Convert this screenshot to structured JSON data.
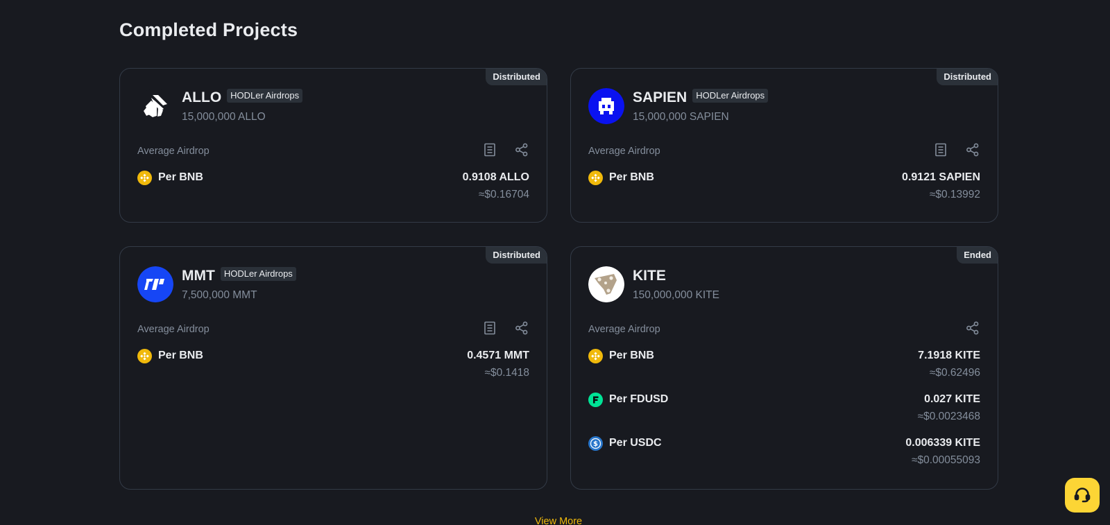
{
  "section": {
    "title": "Completed Projects"
  },
  "projects": [
    {
      "status": "Distributed",
      "name": "ALLO",
      "tag": "HODLer Airdrops",
      "supply": "15,000,000 ALLO",
      "logo_icon": "allo-logo",
      "avg_label": "Average Airdrop",
      "rows": [
        {
          "icon": "bnb-icon",
          "label": "Per BNB",
          "amount": "0.9108 ALLO",
          "usd": "≈$0.16704"
        }
      ]
    },
    {
      "status": "Distributed",
      "name": "SAPIEN",
      "tag": "HODLer Airdrops",
      "supply": "15,000,000 SAPIEN",
      "logo_icon": "sapien-logo",
      "avg_label": "Average Airdrop",
      "rows": [
        {
          "icon": "bnb-icon",
          "label": "Per BNB",
          "amount": "0.9121 SAPIEN",
          "usd": "≈$0.13992"
        }
      ]
    },
    {
      "status": "Distributed",
      "name": "MMT",
      "tag": "HODLer Airdrops",
      "supply": "7,500,000 MMT",
      "logo_icon": "mmt-logo",
      "avg_label": "Average Airdrop",
      "rows": [
        {
          "icon": "bnb-icon",
          "label": "Per BNB",
          "amount": "0.4571 MMT",
          "usd": "≈$0.1418"
        }
      ]
    },
    {
      "status": "Ended",
      "name": "KITE",
      "supply": "150,000,000 KITE",
      "logo_icon": "kite-logo",
      "avg_label": "Average Airdrop",
      "rows": [
        {
          "icon": "bnb-icon",
          "label": "Per BNB",
          "amount": "7.1918 KITE",
          "usd": "≈$0.62496"
        },
        {
          "icon": "fdusd-icon",
          "label": "Per FDUSD",
          "amount": "0.027 KITE",
          "usd": "≈$0.0023468"
        },
        {
          "icon": "usdc-icon",
          "label": "Per USDC",
          "amount": "0.006339 KITE",
          "usd": "≈$0.00055093"
        }
      ]
    }
  ],
  "footer": {
    "view_more": "View More"
  },
  "colors": {
    "background": "#181a20",
    "accent": "#f0b90b",
    "support_button": "#fcd535",
    "muted_text": "#848e9c",
    "card_border": "#333b47"
  }
}
